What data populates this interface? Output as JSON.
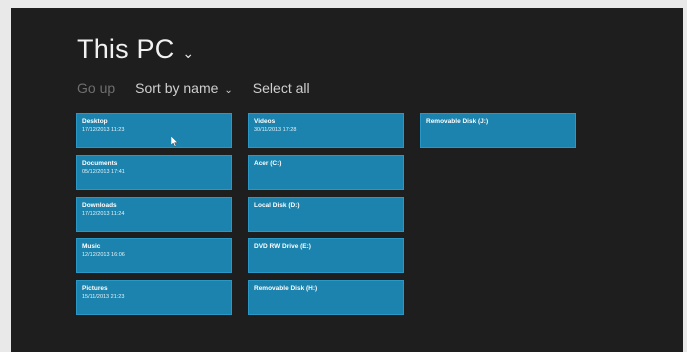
{
  "header": {
    "title": "This PC"
  },
  "toolbar": {
    "go_up": "Go up",
    "sort": "Sort by name",
    "select_all": "Select all"
  },
  "tiles": [
    {
      "name": "Desktop",
      "date": "17/12/2013 11:23"
    },
    {
      "name": "Documents",
      "date": "05/12/2013 17:41"
    },
    {
      "name": "Downloads",
      "date": "17/12/2013 11:24"
    },
    {
      "name": "Music",
      "date": "12/12/2013 16:06"
    },
    {
      "name": "Pictures",
      "date": "15/11/2013 21:23"
    },
    {
      "name": "Videos",
      "date": "30/11/2013 17:28"
    },
    {
      "name": "Acer (C:)",
      "date": ""
    },
    {
      "name": "Local Disk (D:)",
      "date": ""
    },
    {
      "name": "DVD RW Drive (E:)",
      "date": ""
    },
    {
      "name": "Removable Disk (H:)",
      "date": ""
    },
    {
      "name": "Removable Disk (J:)",
      "date": ""
    }
  ],
  "colors": {
    "background": "#1e1e1e",
    "tile": "#1b83ad",
    "text": "#f2f2f2"
  }
}
